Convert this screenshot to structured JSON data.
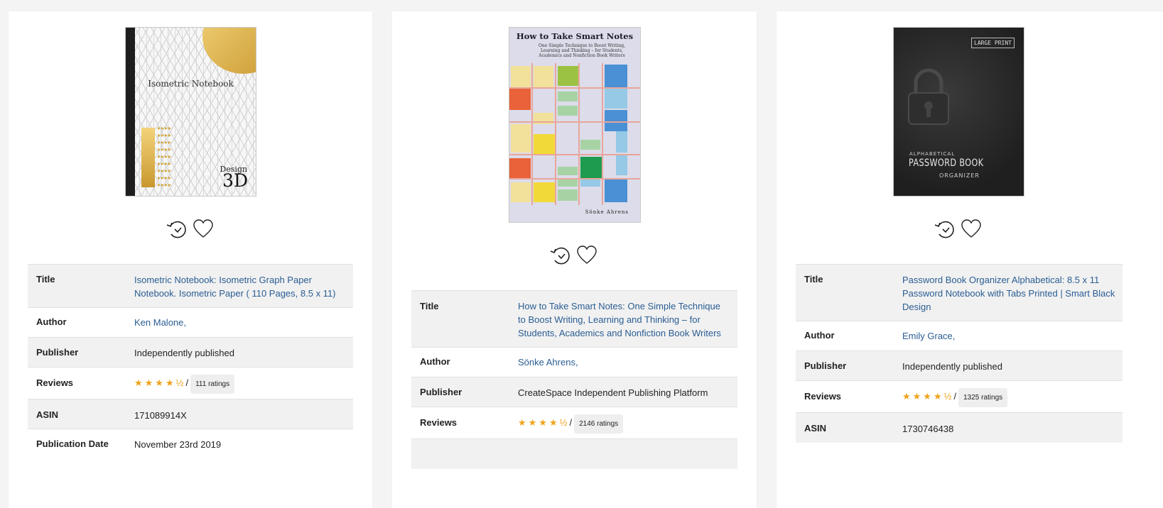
{
  "labels": {
    "title": "Title",
    "author": "Author",
    "publisher": "Publisher",
    "reviews": "Reviews",
    "asin": "ASIN",
    "pubdate": "Publication Date"
  },
  "books": [
    {
      "title": "Isometric Notebook: Isometric Graph Paper Notebook. Isometric Paper ( 110 Pages, 8.5 x 11)",
      "author": "Ken Malone,",
      "publisher": "Independently published",
      "stars": "★★★★½",
      "rating": 4.5,
      "separator": "/",
      "ratings_count": "111 ratings",
      "asin": "171089914X",
      "pubdate": "November 23rd 2019",
      "cover": {
        "title": "Isometric Notebook",
        "sub1": "Design",
        "sub2": "3D"
      }
    },
    {
      "title": "How to Take Smart Notes: One Simple Technique to Boost Writing, Learning and Thinking – for Students, Academics and Nonfiction Book Writers",
      "author": "Sönke Ahrens,",
      "publisher": "CreateSpace Independent Publishing Platform",
      "stars": "★★★★½",
      "rating": 4.5,
      "separator": "/",
      "ratings_count": "2146 ratings",
      "cover": {
        "title": "How to Take Smart Notes",
        "subtitle": "One Simple Technique to Boost Writing, Learning and Thinking – for Students, Academics and Nonfiction Book Writers",
        "author": "Sönke Ahrens"
      }
    },
    {
      "title": "Password Book Organizer Alphabetical: 8.5 x 11 Password Notebook with Tabs Printed | Smart Black Design",
      "author": "Emily Grace,",
      "publisher": "Independently published",
      "stars": "★★★★½",
      "rating": 4.5,
      "separator": "/",
      "ratings_count": "1325 ratings",
      "asin": "1730746438",
      "cover": {
        "badge": "LARGE PRINT",
        "line1": "ALPHABETICAL",
        "line2": "PASSWORD BOOK",
        "line3": "ORGANIZER"
      }
    }
  ],
  "colors": {
    "link": "#2a5d93",
    "star": "#f0a31a",
    "row_alt": "#f1f1f1"
  }
}
